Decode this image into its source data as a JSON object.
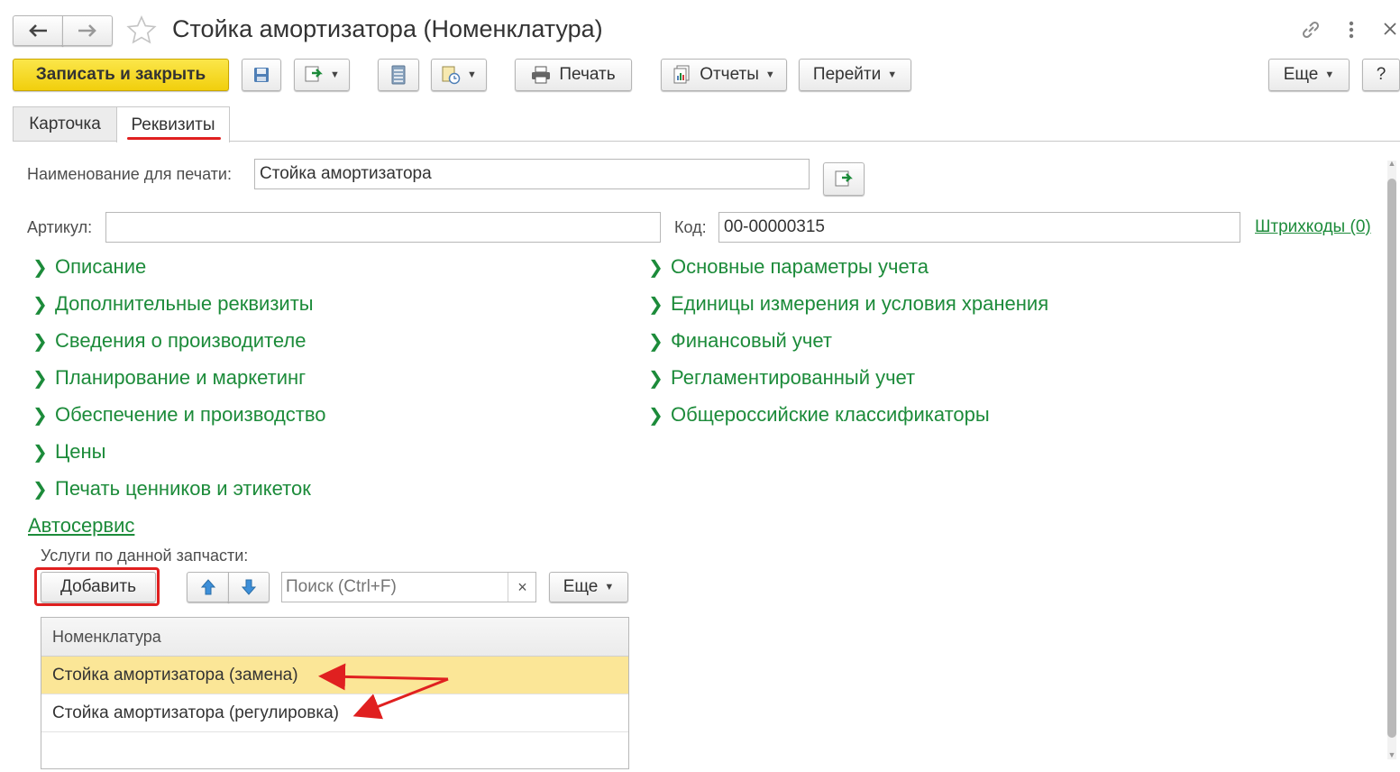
{
  "window": {
    "title": "Стойка амортизатора (Номенклатура)"
  },
  "toolbar": {
    "save_close_label": "Записать и закрыть",
    "print_label": "Печать",
    "reports_label": "Отчеты",
    "goto_label": "Перейти",
    "more_label": "Еще",
    "help_label": "?"
  },
  "tabs": [
    {
      "label": "Карточка",
      "active": false
    },
    {
      "label": "Реквизиты",
      "active": true
    }
  ],
  "form": {
    "print_name_label": "Наименование для печати:",
    "print_name_value": "Стойка амортизатора",
    "article_label": "Артикул:",
    "article_value": "",
    "code_label": "Код:",
    "code_value": "00-00000315",
    "barcodes_link": "Штрихкоды (0)"
  },
  "groups_left": [
    "Описание",
    "Дополнительные реквизиты",
    "Сведения о производителе",
    "Планирование и маркетинг",
    "Обеспечение и производство",
    "Цены",
    "Печать ценников и этикеток"
  ],
  "groups_right": [
    "Основные параметры учета",
    "Единицы измерения и условия хранения",
    "Финансовый учет",
    "Регламентированный учет",
    "Общероссийские классификаторы"
  ],
  "autoservice": {
    "title": "Автосервис",
    "services_label": "Услуги по данной запчасти:",
    "add_label": "Добавить",
    "search_placeholder": "Поиск (Ctrl+F)",
    "more_label": "Еще",
    "clear_symbol": "×",
    "column_header": "Номенклатура",
    "rows": [
      {
        "text": "Стойка амортизатора (замена)",
        "selected": true
      },
      {
        "text": "Стойка амортизатора (регулировка)",
        "selected": false
      }
    ]
  },
  "colors": {
    "accent_green": "#1c8b3a",
    "primary_yellow": "#f5d820",
    "selected_row": "#fbe697",
    "annotation_red": "#e02020"
  }
}
